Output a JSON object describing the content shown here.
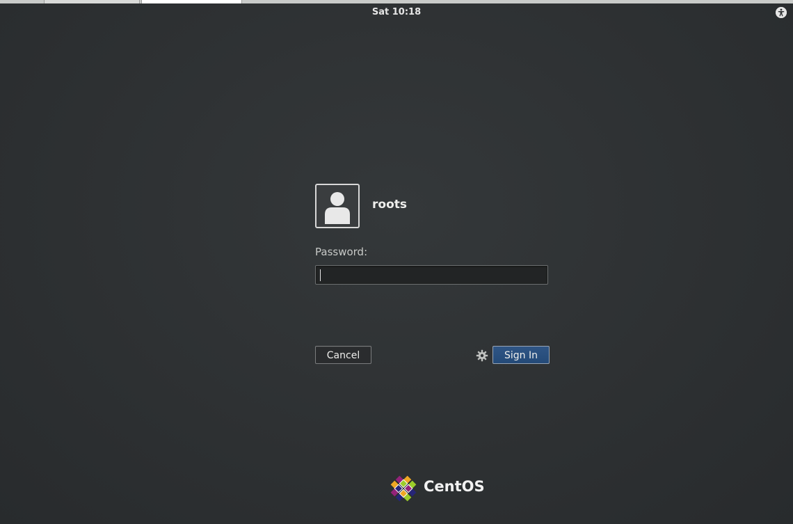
{
  "top_bar": {
    "clock": "Sat 10:18",
    "accessibility_icon": "accessibility-icon"
  },
  "login": {
    "username": "roots",
    "avatar_icon": "user-avatar-icon",
    "password_label": "Password:",
    "password_value": "",
    "cancel_label": "Cancel",
    "session_icon": "gear-icon",
    "sign_in_label": "Sign In"
  },
  "branding": {
    "logo_icon": "centos-logo-icon",
    "logo_text": "CentOS"
  },
  "colors": {
    "background": "#2e3133",
    "sign_in_button": "#2f5585",
    "text": "#eeeeec"
  }
}
